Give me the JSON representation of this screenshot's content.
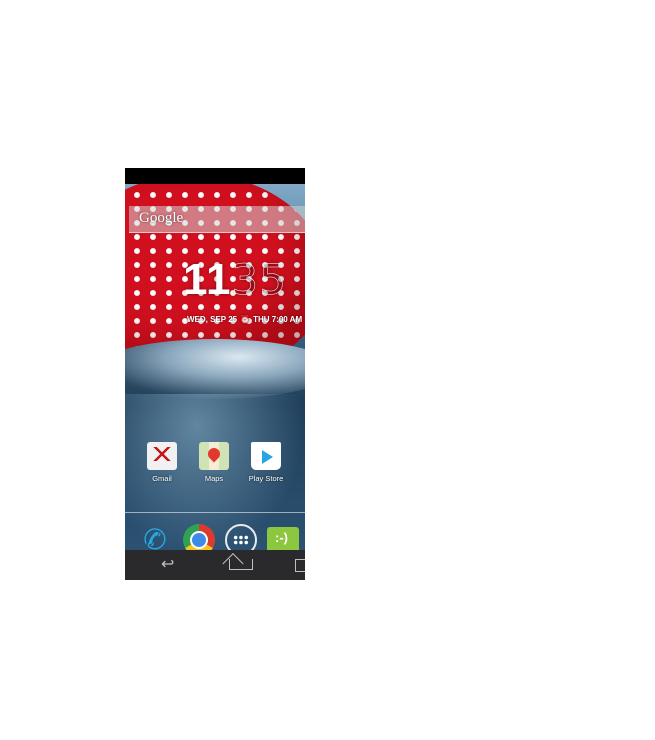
{
  "search": {
    "label": "Google"
  },
  "clock": {
    "hour": "11",
    "minute": "35"
  },
  "date": {
    "date_text": "WED, SEP 25",
    "alarm_icon": "alarm-icon",
    "alarm_text": "THU 7:00 AM"
  },
  "apps": [
    {
      "label": "Gmail",
      "icon": "gmail-icon"
    },
    {
      "label": "Maps",
      "icon": "maps-icon"
    },
    {
      "label": "Play Store",
      "icon": "play-store-icon"
    }
  ],
  "dock": [
    {
      "icon": "phone-icon"
    },
    {
      "icon": "chrome-icon"
    },
    {
      "icon": "all-apps-icon"
    },
    {
      "icon": "messaging-icon"
    }
  ],
  "nav": {
    "back": "↩",
    "home": "home-icon",
    "recents": "recents-icon"
  },
  "colors": {
    "accent_red": "#d1101f",
    "chrome_blue": "#3d8be5",
    "messaging_green": "#8dc63f",
    "nav_bar": "#2a2a2c"
  }
}
